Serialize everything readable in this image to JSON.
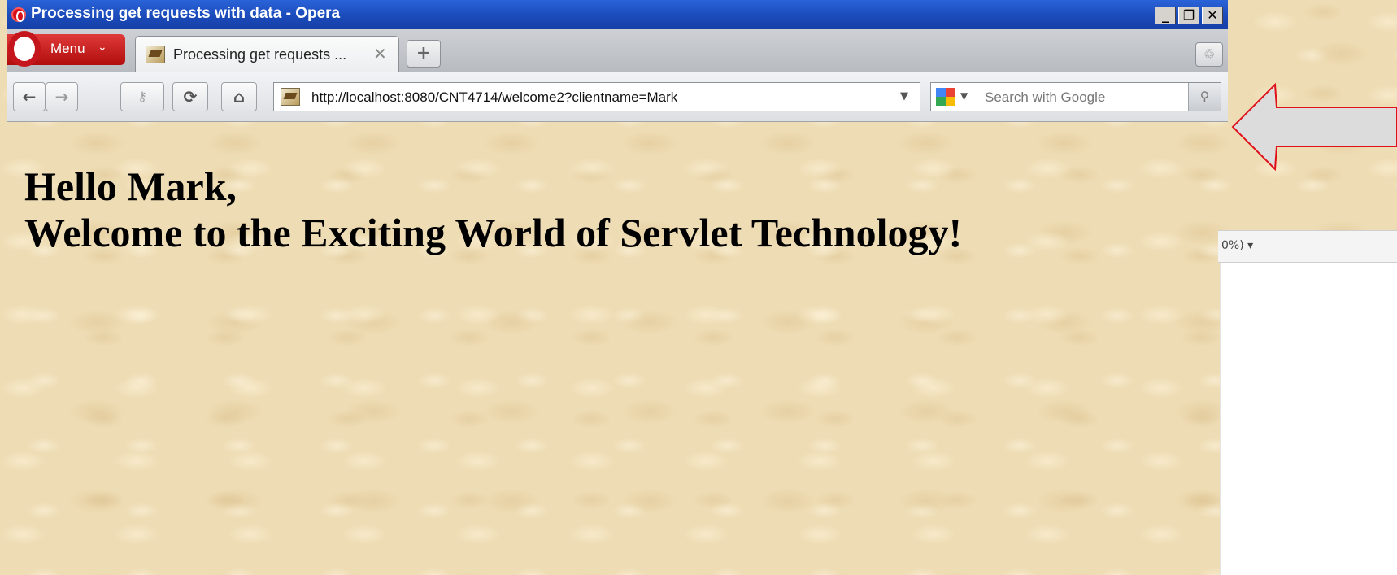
{
  "window": {
    "title": "Processing get requests with data - Opera",
    "controls": {
      "minimize": "_",
      "maximize": "❐",
      "close": "✕"
    }
  },
  "tabbar": {
    "menu_label": "Menu",
    "tabs": [
      {
        "title": "Processing get requests ...",
        "active": true
      }
    ],
    "new_tab_symbol": "+"
  },
  "toolbar": {
    "buttons": [
      "back-icon",
      "forward-icon",
      "key-icon",
      "reload-icon",
      "home-icon"
    ],
    "address": "http://localhost:8080/CNT4714/welcome2?clientname=Mark",
    "search_placeholder": "Search with Google"
  },
  "page": {
    "greeting_line1": "Hello Mark,",
    "greeting_line2": "Welcome to the Exciting World of Servlet Technology!"
  },
  "slide": {
    "partial_zoom_text": "0%) ▾"
  },
  "colors": {
    "titlebar": "#1a49b8",
    "menu_button": "#c4161c",
    "page_background": "#eedcb4",
    "callout_stroke": "#e0101a"
  }
}
